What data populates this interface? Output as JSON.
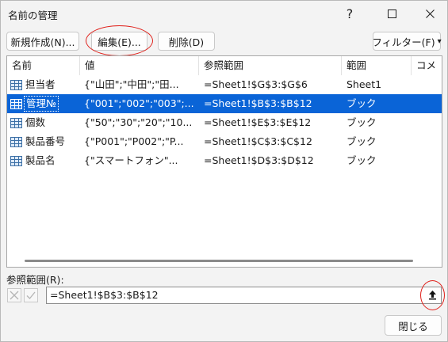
{
  "window": {
    "title": "名前の管理",
    "help_glyph": "?"
  },
  "toolbar": {
    "new_label": "新規作成(N)...",
    "edit_label": "編集(E)...",
    "delete_label": "削除(D)",
    "filter_label": "フィルター(F)",
    "filter_arrow": "▾"
  },
  "list": {
    "columns": [
      "名前",
      "値",
      "参照範囲",
      "範囲",
      "コメ"
    ],
    "rows": [
      {
        "name": "担当者",
        "value": "{\"山田\";\"中田\";\"田...",
        "refers_to": "=Sheet1!$G$3:$G$6",
        "scope": "Sheet1",
        "selected": false
      },
      {
        "name": "管理№",
        "value": "{\"001\";\"002\";\"003\";...",
        "refers_to": "=Sheet1!$B$3:$B$12",
        "scope": "ブック",
        "selected": true
      },
      {
        "name": "個数",
        "value": "{\"50\";\"30\";\"20\";\"10...",
        "refers_to": "=Sheet1!$E$3:$E$12",
        "scope": "ブック",
        "selected": false
      },
      {
        "name": "製品番号",
        "value": "{\"P001\";\"P002\";\"P...",
        "refers_to": "=Sheet1!$C$3:$C$12",
        "scope": "ブック",
        "selected": false
      },
      {
        "name": "製品名",
        "value": "{\"スマートフォン\"...",
        "refers_to": "=Sheet1!$D$3:$D$12",
        "scope": "ブック",
        "selected": false
      }
    ]
  },
  "refers_to": {
    "label": "参照範囲(R):",
    "value": "=Sheet1!$B$3:$B$12"
  },
  "footer": {
    "close_label": "閉じる"
  },
  "colors": {
    "selection": "#0a64d7",
    "annotation": "#e0201a"
  },
  "icons": {
    "name_row": "grid-icon",
    "collapse": "collapse-arrow-up-icon",
    "cancel": "cancel-x-icon",
    "ok": "check-icon"
  }
}
